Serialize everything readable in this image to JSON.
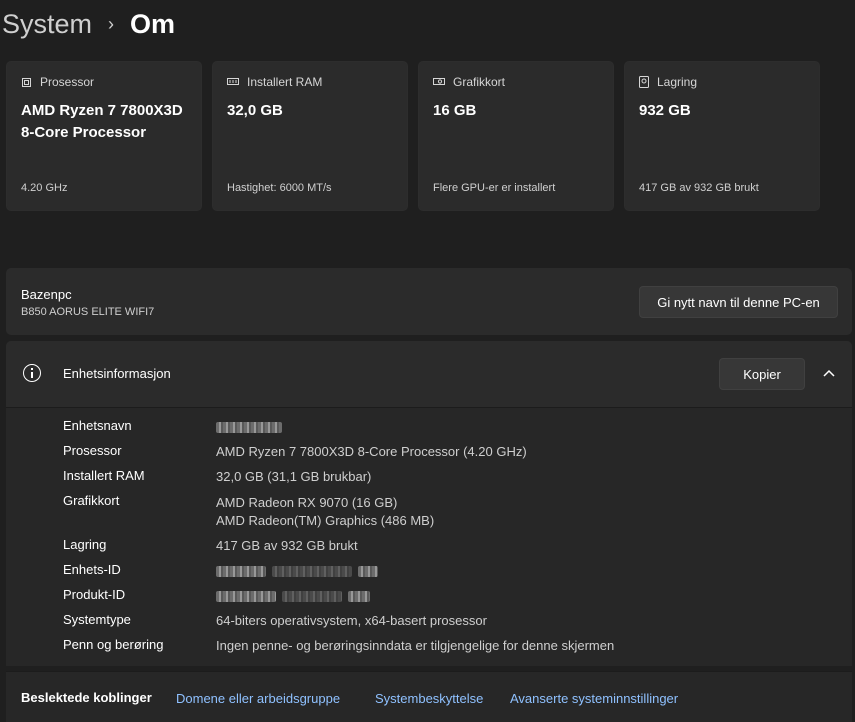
{
  "breadcrumb": {
    "parent": "System",
    "separator": "›",
    "current": "Om"
  },
  "cards": [
    {
      "icon": "processor-icon",
      "label": "Prosessor",
      "value": "AMD Ryzen 7 7800X3D 8-Core Processor",
      "sub": "4.20 GHz"
    },
    {
      "icon": "ram-icon",
      "label": "Installert RAM",
      "value": "32,0 GB",
      "sub": "Hastighet: 6000 MT/s"
    },
    {
      "icon": "graphics-card-icon",
      "label": "Grafikkort",
      "value": "16 GB",
      "sub": "Flere GPU-er er installert"
    },
    {
      "icon": "storage-icon",
      "label": "Lagring",
      "value": "932 GB",
      "sub": "417 GB av 932 GB brukt"
    }
  ],
  "pc": {
    "name": "Bazenpc",
    "model": "B850 AORUS ELITE WIFI7",
    "rename_label": "Gi nytt navn til denne PC-en"
  },
  "device_info": {
    "title": "Enhetsinformasjon",
    "copy_label": "Kopier",
    "rows": [
      {
        "label": "Enhetsnavn",
        "value": ""
      },
      {
        "label": "Prosessor",
        "value": "AMD Ryzen 7 7800X3D 8-Core Processor (4.20 GHz)"
      },
      {
        "label": "Installert RAM",
        "value": "32,0 GB (31,1 GB brukbar)"
      },
      {
        "label": "Grafikkort",
        "value": "AMD Radeon RX 9070 (16 GB)",
        "value2": "AMD Radeon(TM) Graphics (486 MB)"
      },
      {
        "label": "Lagring",
        "value": "417 GB av 932 GB brukt"
      },
      {
        "label": "Enhets-ID",
        "value": ""
      },
      {
        "label": "Produkt-ID",
        "value": ""
      },
      {
        "label": "Systemtype",
        "value": "64-biters operativsystem, x64-basert prosessor"
      },
      {
        "label": "Penn og berøring",
        "value": "Ingen penne- og berøringsinndata er tilgjengelige for denne skjermen"
      }
    ]
  },
  "related": {
    "label": "Beslektede koblinger",
    "links": [
      "Domene eller arbeidsgruppe",
      "Systembeskyttelse",
      "Avanserte systeminnstillinger"
    ]
  },
  "colors": {
    "background": "#1f1f1f",
    "card": "#2b2b2b",
    "link": "#8fc1ff"
  }
}
